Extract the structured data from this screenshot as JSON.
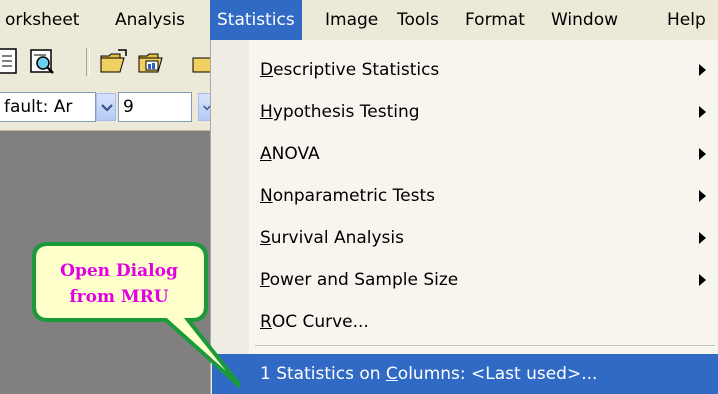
{
  "menubar": {
    "items": [
      "orksheet",
      "Analysis",
      "Statistics",
      "Image",
      "Tools",
      "Format",
      "Window",
      "Help"
    ],
    "active": "Statistics"
  },
  "toolbar": {
    "icons": [
      "page-icon",
      "print-preview-icon",
      "open-folder-icon",
      "open-template-icon",
      "open-folder-partial-icon"
    ],
    "font_value": "fault: Ar",
    "size_value": "9"
  },
  "statistics_menu": {
    "items": [
      {
        "pre": "",
        "u": "D",
        "post": "escriptive Statistics",
        "submenu": true
      },
      {
        "pre": "",
        "u": "H",
        "post": "ypothesis Testing",
        "submenu": true
      },
      {
        "pre": "",
        "u": "A",
        "post": "NOVA",
        "submenu": true
      },
      {
        "pre": "",
        "u": "N",
        "post": "onparametric Tests",
        "submenu": true
      },
      {
        "pre": "",
        "u": "S",
        "post": "urvival Analysis",
        "submenu": true
      },
      {
        "pre": "",
        "u": "P",
        "post": "ower and Sample Size",
        "submenu": true
      },
      {
        "pre": "",
        "u": "R",
        "post": "OC Curve...",
        "submenu": false
      }
    ],
    "mru_item": {
      "pre": "1 Statistics on ",
      "u": "C",
      "post": "olumns: <Last used>..."
    }
  },
  "callout": {
    "line1": "Open Dialog",
    "line2": "from MRU",
    "fill": "#ffffcc",
    "border": "#1a9a3a",
    "text_color": "#e000e0"
  },
  "colors": {
    "highlight": "#316ac5",
    "menubar_bg": "#ece9d8",
    "workspace_bg": "#808080"
  }
}
